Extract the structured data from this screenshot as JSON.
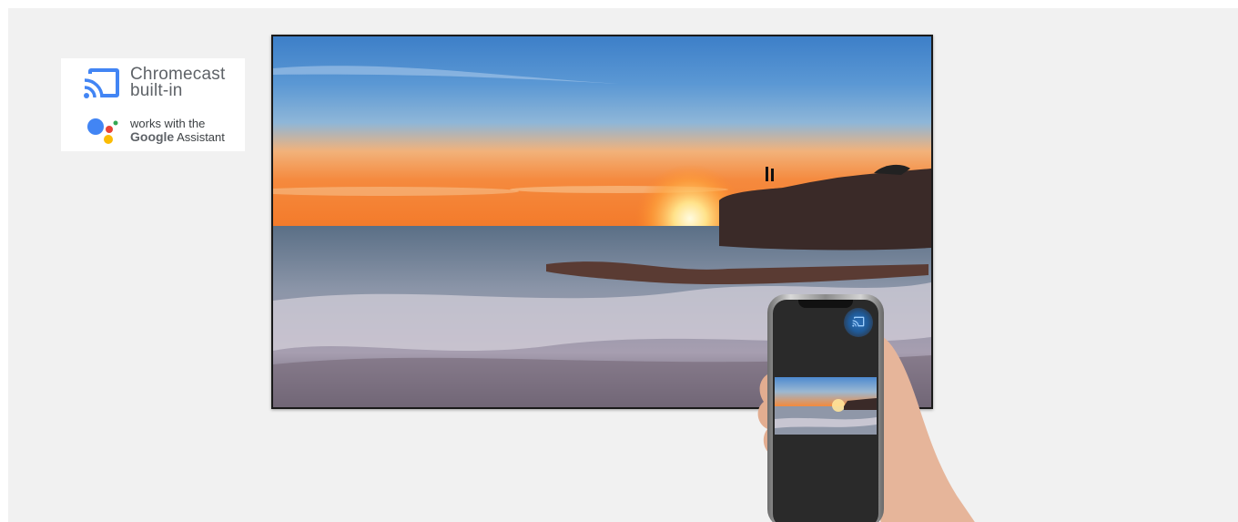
{
  "badges": {
    "chromecast_line1": "Chromecast",
    "chromecast_line2": "built-in",
    "assistant_line1": "works with the",
    "assistant_brand": "Google",
    "assistant_word": "Assistant"
  },
  "icons": {
    "cast": "cast-icon",
    "assistant": "google-assistant-icon",
    "phone_cast": "cast-button-icon"
  },
  "colors": {
    "background": "#f1f1f1",
    "cast_icon": "#4285f4",
    "assistant_blue": "#4285f4",
    "assistant_red": "#ea4335",
    "assistant_yellow": "#fbbc04",
    "assistant_green": "#34a853",
    "cast_button": "#2b6fb8"
  }
}
